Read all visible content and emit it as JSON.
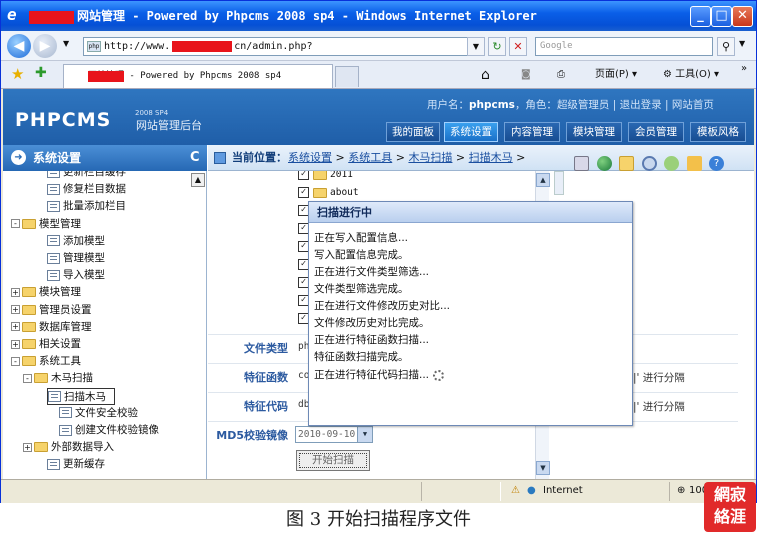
{
  "window": {
    "title": "网站管理 - Powered by Phpcms 2008 sp4 - Windows Internet Explorer",
    "address": "http://www.",
    "address_suffix": "cn/admin.php?",
    "search_placeholder": "Google",
    "tab_title": "网站管理 - Powered by Phpcms 2008 sp4",
    "page_menu": "页面(P)",
    "tools_menu": "工具(O)",
    "minimize": "_",
    "maximize": "□",
    "close": "✕",
    "more": "»"
  },
  "header": {
    "logo": "PHPCMS",
    "logo_version": "2008 SP4",
    "logo_subtitle": "网站管理后台",
    "user_label": "用户名：",
    "username": "phpcms",
    "role_label": "，角色：",
    "role": "超级管理员",
    "logout": "退出登录",
    "site_home": "网站首页",
    "menu": [
      "我的面板",
      "系统设置",
      "内容管理",
      "模块管理",
      "会员管理",
      "模板风格"
    ]
  },
  "sidebar": {
    "title": "系统设置",
    "refresh_icon": "C",
    "items": [
      {
        "label": "更新栏目缓存",
        "kind": "page"
      },
      {
        "label": "修复栏目数据",
        "kind": "page"
      },
      {
        "label": "批量添加栏目",
        "kind": "page"
      },
      {
        "label": "模型管理",
        "kind": "folder",
        "pm": "-"
      },
      {
        "label": "添加模型",
        "kind": "page"
      },
      {
        "label": "管理模型",
        "kind": "page"
      },
      {
        "label": "导入模型",
        "kind": "page"
      },
      {
        "label": "模块管理",
        "kind": "folder",
        "pm": "+"
      },
      {
        "label": "管理员设置",
        "kind": "folder",
        "pm": "+"
      },
      {
        "label": "数据库管理",
        "kind": "folder",
        "pm": "+"
      },
      {
        "label": "相关设置",
        "kind": "folder",
        "pm": "+"
      },
      {
        "label": "系统工具",
        "kind": "folder",
        "pm": "-"
      },
      {
        "label": "木马扫描",
        "kind": "folder",
        "pm": "-"
      },
      {
        "label": "扫描木马",
        "kind": "page",
        "selected": true
      },
      {
        "label": "文件安全校验",
        "kind": "page"
      },
      {
        "label": "创建文件校验镜像",
        "kind": "page"
      },
      {
        "label": "外部数据导入",
        "kind": "folder",
        "pm": "+"
      },
      {
        "label": "更新缓存",
        "kind": "page"
      }
    ]
  },
  "breadcrumb": {
    "label": "当前位置：",
    "items": [
      "系统设置",
      "系统工具",
      "木马扫描",
      "扫描木马"
    ]
  },
  "file_list": [
    "2011",
    "about"
  ],
  "form": {
    "file_type_label": "文件类型",
    "file_type_value": "php",
    "feature_func_label": "特征函数",
    "feature_func_value": "co",
    "feature_code_label": "特征代码",
    "feature_code_value": "db",
    "separator_note": "|' 进行分隔",
    "md5_label": "MD5校验镜像",
    "md5_value": "2010-09-10",
    "start_button": "开始扫描"
  },
  "dialog": {
    "title": "扫描进行中",
    "lines": [
      "正在写入配置信息...",
      "写入配置信息完成。",
      "正在进行文件类型筛选...",
      "文件类型筛选完成。",
      "正在进行文件修改历史对比...",
      "文件修改历史对比完成。",
      "正在进行特征函数扫描...",
      "特征函数扫描完成。",
      "正在进行特征代码扫描..."
    ]
  },
  "statusbar": {
    "zone": "Internet",
    "zoom": "100"
  },
  "caption": "图 3  开始扫描程序文件",
  "stamp": {
    "text": "網絡 寂涯"
  },
  "colors": {
    "header": "#2f76c0",
    "accent": "#3aa0ee",
    "redaction": "#e8141b",
    "stamp": "#e12a2a"
  }
}
